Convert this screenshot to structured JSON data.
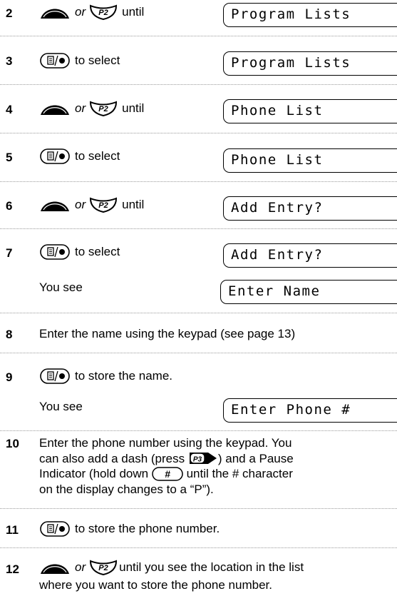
{
  "steps": [
    {
      "num": "2",
      "or": "or",
      "action": "until",
      "display": "Program Lists"
    },
    {
      "num": "3",
      "action": "to select",
      "display": "Program Lists"
    },
    {
      "num": "4",
      "or": "or",
      "action": "until",
      "display": "Phone List"
    },
    {
      "num": "5",
      "action": "to select",
      "display": "Phone List"
    },
    {
      "num": "6",
      "or": "or",
      "action": "until",
      "display": "Add Entry?"
    },
    {
      "num": "7",
      "action": "to select",
      "display": "Add Entry?",
      "you_see": "You see",
      "display2": "Enter Name"
    },
    {
      "num": "8",
      "text": "Enter the name using the keypad (see page 13)"
    },
    {
      "num": "9",
      "action": "to store the name.",
      "you_see": "You see",
      "display2": "Enter Phone #"
    },
    {
      "num": "10",
      "t1": "Enter the phone number using the keypad. You",
      "t2": "can also add a dash (press",
      "t3": ") and a Pause",
      "t4": "Indicator (hold down",
      "t5": "until the # character",
      "t6": "on the display changes to a “P”)."
    },
    {
      "num": "11",
      "action": "to store the phone number."
    },
    {
      "num": "12",
      "or": "or",
      "t1": "until you see the location in the list",
      "t2": "where you want to store the phone number."
    }
  ],
  "keys": {
    "p2": "P2",
    "p3": "P3",
    "pound": "#"
  }
}
